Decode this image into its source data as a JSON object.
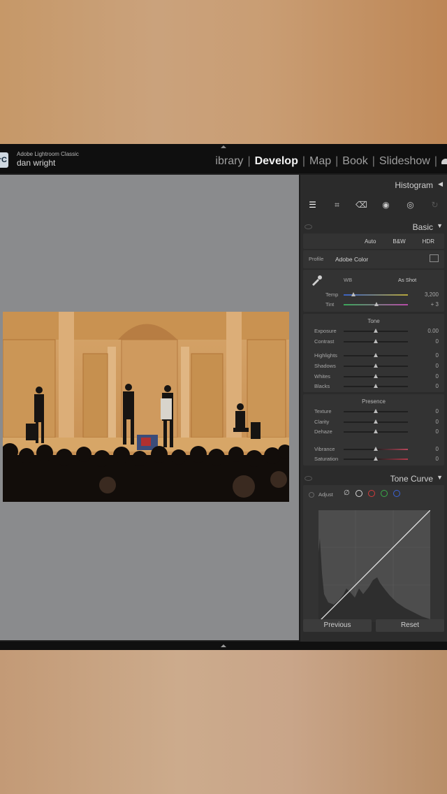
{
  "app": {
    "name": "Adobe Lightroom Classic",
    "user": "dan wright",
    "logo_text": "rC",
    "modules": [
      "ibrary",
      "Develop",
      "Map",
      "Book",
      "Slideshow"
    ],
    "active_module": "Develop"
  },
  "panels": {
    "histogram": {
      "label": "Histogram"
    },
    "basic": {
      "label": "Basic",
      "buttons": [
        "Auto",
        "B&W",
        "HDR"
      ],
      "profile_label": "Profile",
      "profile_value": "Adobe Color",
      "wb_label": "WB",
      "wb_value": "As Shot",
      "temp": {
        "label": "Temp",
        "value": "3,200",
        "level": 0.15
      },
      "tint": {
        "label": "Tint",
        "value": "+ 3",
        "level": 0.51
      },
      "tone_title": "Tone",
      "tone": [
        {
          "label": "Exposure",
          "value": "0.00",
          "level": 0.5
        },
        {
          "label": "Contrast",
          "value": "0",
          "level": 0.5
        },
        {
          "label": "Highlights",
          "value": "0",
          "level": 0.5
        },
        {
          "label": "Shadows",
          "value": "0",
          "level": 0.5
        },
        {
          "label": "Whites",
          "value": "0",
          "level": 0.5
        },
        {
          "label": "Blacks",
          "value": "0",
          "level": 0.5
        }
      ],
      "presence_title": "Presence",
      "presence": [
        {
          "label": "Texture",
          "value": "0",
          "level": 0.5
        },
        {
          "label": "Clarity",
          "value": "0",
          "level": 0.5
        },
        {
          "label": "Dehaze",
          "value": "0",
          "level": 0.5
        },
        {
          "label": "Vibrance",
          "value": "0",
          "level": 0.5
        },
        {
          "label": "Saturation",
          "value": "0",
          "level": 0.5
        }
      ]
    },
    "tone_curve": {
      "label": "Tone Curve",
      "adjust_label": "Adjust",
      "channel_colors": [
        "#d8d8d8",
        "#d33b3b",
        "#3aae4a",
        "#3b63d8"
      ]
    }
  },
  "buttons": {
    "previous": "Previous",
    "reset": "Reset"
  }
}
